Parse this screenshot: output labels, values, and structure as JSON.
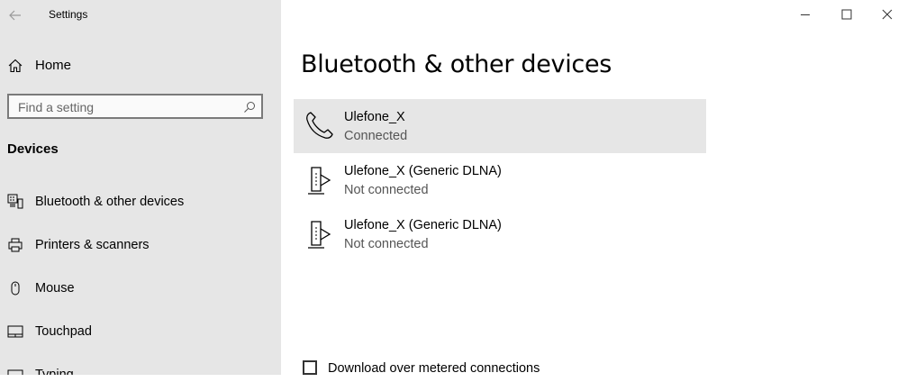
{
  "window": {
    "title": "Settings",
    "controls": [
      "minimize-icon",
      "maximize-icon",
      "close-icon"
    ]
  },
  "sidebar": {
    "home_label": "Home",
    "search_placeholder": "Find a setting",
    "section_title": "Devices",
    "items": [
      {
        "label": "Bluetooth & other devices",
        "icon": "bluetooth-devices-icon"
      },
      {
        "label": "Printers & scanners",
        "icon": "printer-icon"
      },
      {
        "label": "Mouse",
        "icon": "mouse-icon"
      },
      {
        "label": "Touchpad",
        "icon": "touchpad-icon"
      },
      {
        "label": "Typing",
        "icon": "keyboard-icon"
      }
    ]
  },
  "main": {
    "page_title": "Bluetooth & other devices",
    "devices": [
      {
        "name": "Ulefone_X",
        "status": "Connected",
        "icon": "phone-icon",
        "selected": true
      },
      {
        "name": "Ulefone_X (Generic DLNA)",
        "status": "Not connected",
        "icon": "media-device-icon",
        "selected": false
      },
      {
        "name": "Ulefone_X (Generic DLNA)",
        "status": "Not connected",
        "icon": "media-device-icon",
        "selected": false
      }
    ],
    "metered_label": "Download over metered connections",
    "metered_checked": false
  },
  "colors": {
    "sidebar_bg": "#e6e6e6",
    "selected_bg": "#e6e6e6",
    "secondary_text": "#555555"
  }
}
